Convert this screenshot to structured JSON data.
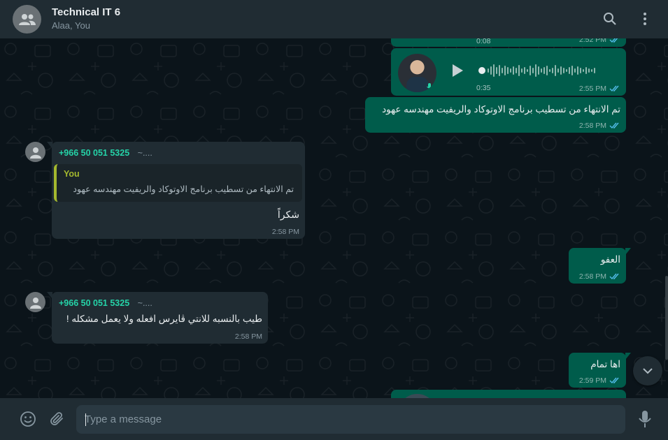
{
  "header": {
    "title": "Technical IT 6",
    "subtitle": "Alaa, You"
  },
  "messages": [
    {
      "direction": "out",
      "type": "voice",
      "duration": "0:08",
      "time": "2:52 PM",
      "status": "read"
    },
    {
      "direction": "out",
      "type": "voice",
      "duration": "0:35",
      "time": "2:55 PM",
      "status": "read"
    },
    {
      "direction": "out",
      "type": "text",
      "text": "تم الانتهاء من تسطيب برنامج الاوتوكاد والريفيت مهندسه عهود",
      "time": "2:58 PM",
      "status": "read"
    },
    {
      "direction": "in",
      "type": "reply",
      "sender_phone": "+966 50 051 5325",
      "sender_alias": "~....",
      "quote_author": "You",
      "quote_text": "تم الانتهاء من تسطيب برنامج الاوتوكاد والريفيت مهندسه عهود",
      "text": "شكراً",
      "time": "2:58 PM"
    },
    {
      "direction": "out",
      "type": "text",
      "text": "العفو",
      "time": "2:58 PM",
      "status": "read"
    },
    {
      "direction": "in",
      "type": "text",
      "sender_phone": "+966 50 051 5325",
      "sender_alias": "~....",
      "text": "طيب بالنسبه للانتي ڤايرس افعله ولا يعمل مشكله !",
      "time": "2:58 PM"
    },
    {
      "direction": "out",
      "type": "text",
      "text": "اها تمام",
      "time": "2:59 PM",
      "status": "read"
    }
  ],
  "composer": {
    "placeholder": "Type a message"
  },
  "icons": {
    "group_avatar": "group-icon",
    "search": "search-icon",
    "menu": "kebab-menu-icon",
    "emoji": "emoji-icon",
    "attach": "paperclip-icon",
    "mic": "microphone-icon",
    "scroll_down": "chevron-down-icon",
    "read_receipt": "double-check-icon"
  },
  "colors": {
    "header_bg": "#202c33",
    "chat_bg": "#0b141a",
    "outgoing_bubble": "#005c4b",
    "incoming_bubble": "#202c33",
    "read_tick": "#53bdeb",
    "sender_name": "#25d3a8",
    "quote_accent": "#a4b82e"
  }
}
